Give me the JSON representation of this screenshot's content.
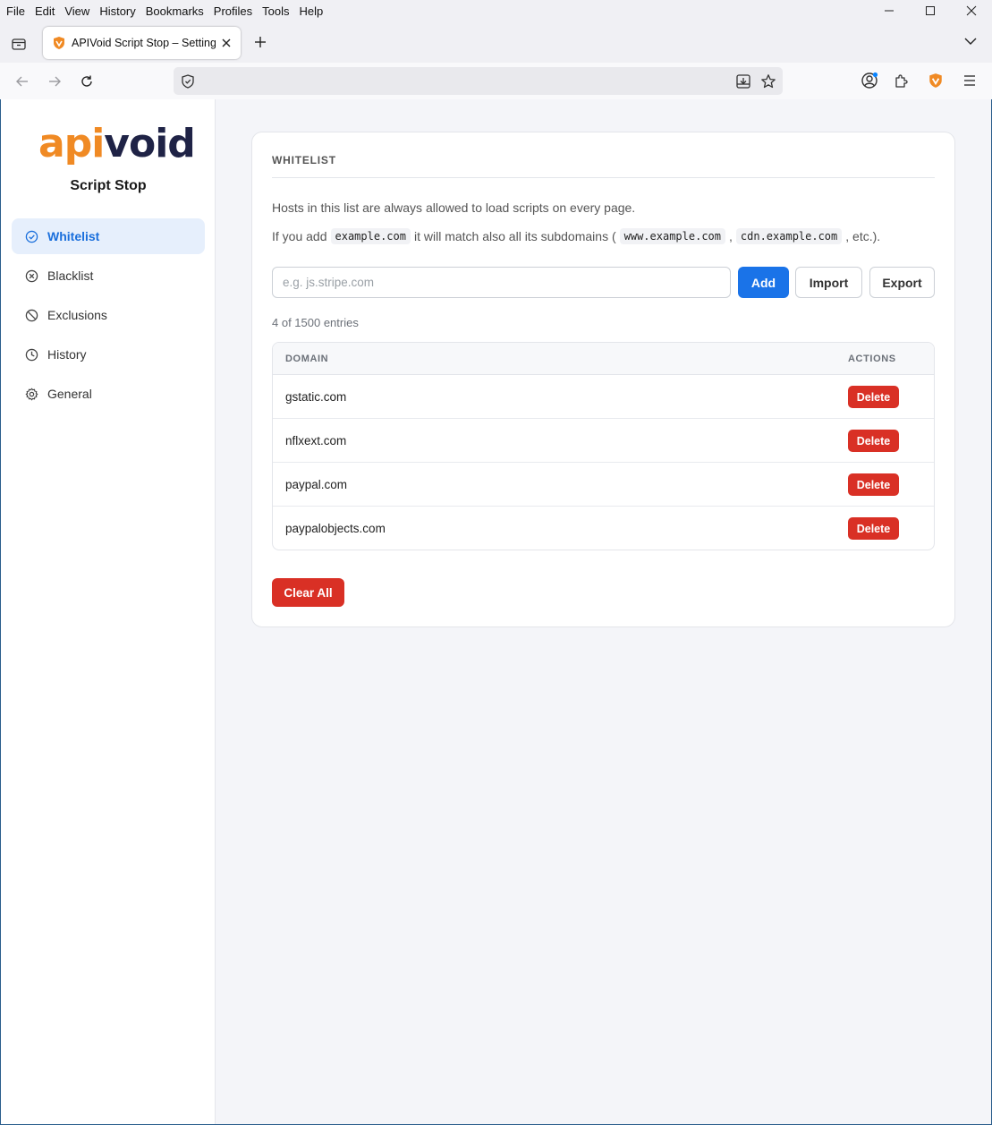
{
  "menubar": {
    "items": [
      {
        "label": "File"
      },
      {
        "label": "Edit"
      },
      {
        "label": "View"
      },
      {
        "label": "History"
      },
      {
        "label": "Bookmarks"
      },
      {
        "label": "Profiles"
      },
      {
        "label": "Tools"
      },
      {
        "label": "Help"
      }
    ]
  },
  "tab": {
    "title": "APIVoid Script Stop – Settings"
  },
  "urlbar": {
    "value": ""
  },
  "sidebar": {
    "logo": {
      "part1": "api",
      "part2": "void"
    },
    "product_name": "Script Stop",
    "items": [
      {
        "label": "Whitelist",
        "icon": "check-circle-icon",
        "active": true
      },
      {
        "label": "Blacklist",
        "icon": "x-circle-icon",
        "active": false
      },
      {
        "label": "Exclusions",
        "icon": "ban-icon",
        "active": false
      },
      {
        "label": "History",
        "icon": "clock-icon",
        "active": false
      },
      {
        "label": "General",
        "icon": "gear-icon",
        "active": false
      }
    ]
  },
  "main": {
    "section_title": "WHITELIST",
    "description_1": "Hosts in this list are always allowed to load scripts on every page.",
    "description_2": {
      "prefix": "If you add",
      "example": "example.com",
      "middle": "it will match also all its subdomains (",
      "sub1": "www.example.com",
      "comma": ",",
      "sub2": "cdn.example.com",
      "suffix": ", etc.)."
    },
    "input": {
      "placeholder": "e.g. js.stripe.com",
      "value": ""
    },
    "add_label": "Add",
    "import_label": "Import",
    "export_label": "Export",
    "entries_count": "4 of 1500 entries",
    "table": {
      "columns": [
        "DOMAIN",
        "ACTIONS"
      ],
      "rows": [
        {
          "domain": "gstatic.com",
          "action": "Delete"
        },
        {
          "domain": "nflxext.com",
          "action": "Delete"
        },
        {
          "domain": "paypal.com",
          "action": "Delete"
        },
        {
          "domain": "paypalobjects.com",
          "action": "Delete"
        }
      ]
    },
    "clear_all_label": "Clear All"
  },
  "colors": {
    "accent": "#1a73e8",
    "danger": "#d93025",
    "brand_orange": "#f08a24",
    "brand_navy": "#1f2346",
    "active_nav_bg": "#e6effc"
  }
}
